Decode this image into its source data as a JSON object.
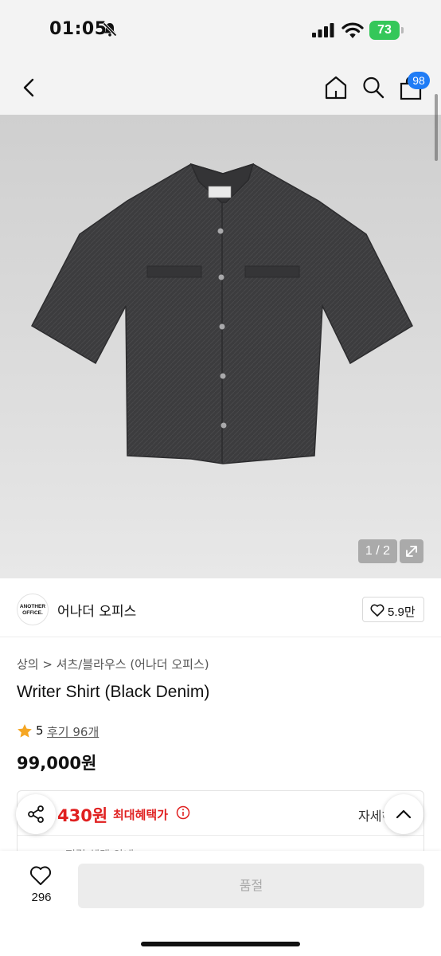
{
  "status_bar": {
    "time": "01:05",
    "battery": "73"
  },
  "header": {
    "cart_badge": "98"
  },
  "gallery": {
    "counter": "1 / 2",
    "shirt_color": "#3c3c3e"
  },
  "brand": {
    "logo_text_line1": "ANOTHER",
    "logo_text_line2": "OFFICE.",
    "name": "어나더 오피스",
    "like_count": "5.9만"
  },
  "product": {
    "breadcrumb": "상의 > 셔츠/블라우스 (어나더 오피스)",
    "title": "Writer Shirt (Black Denim)",
    "rating": "5",
    "review_link": "후기 96개",
    "price": "99,000원"
  },
  "benefit": {
    "amount": "430원",
    "label": "최대혜택가",
    "detail_link": "자세히",
    "hidden_row": "적립 혜택 안내"
  },
  "bottom_bar": {
    "wish_count": "296",
    "soldout_label": "품절"
  },
  "colors": {
    "accent_blue": "#1f7cf5",
    "benefit_red": "#e02020",
    "battery_green": "#34c759",
    "star_orange": "#f5a623"
  }
}
